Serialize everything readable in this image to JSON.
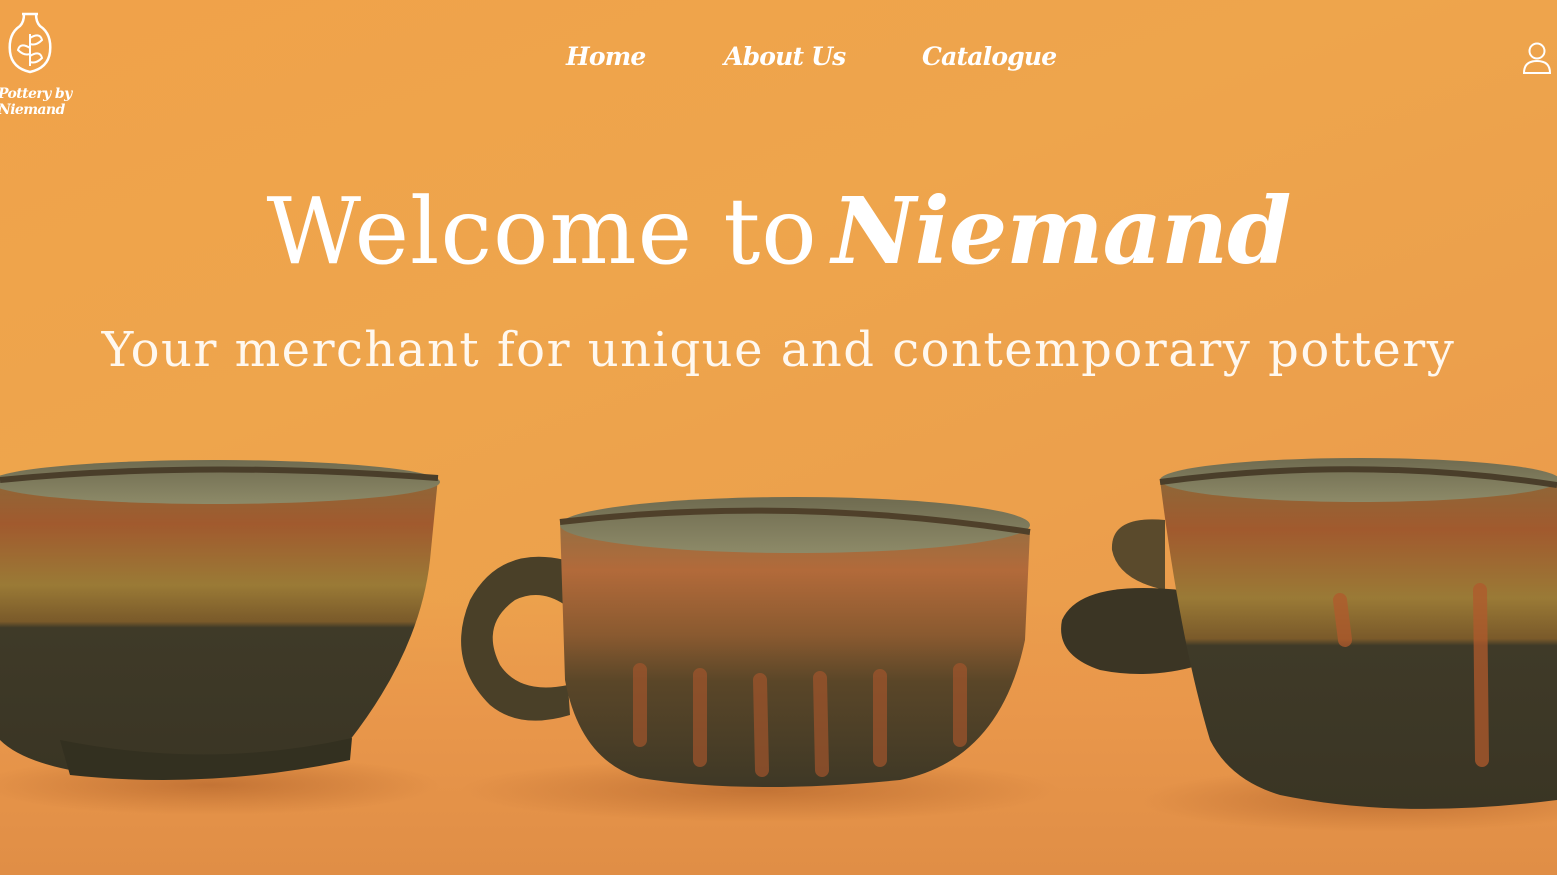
{
  "brand": {
    "logo_icon": "vase-with-leaf-icon",
    "logo_text_line1": "Pottery by",
    "logo_text_line2": "Niemand"
  },
  "nav": {
    "items": [
      {
        "label": "Home"
      },
      {
        "label": "About Us"
      },
      {
        "label": "Catalogue"
      }
    ],
    "account_icon": "user-icon"
  },
  "hero": {
    "title_prefix": "Welcome to",
    "title_brand": "Niemand",
    "subtitle": "Your merchant for unique and contemporary pottery",
    "background_image": "three-handmade-glazed-ceramic-cups"
  },
  "colors": {
    "background": "#eea54c",
    "text": "#ffffff",
    "cup_dark": "#3f3a2a",
    "cup_glaze": "#b0662f"
  }
}
